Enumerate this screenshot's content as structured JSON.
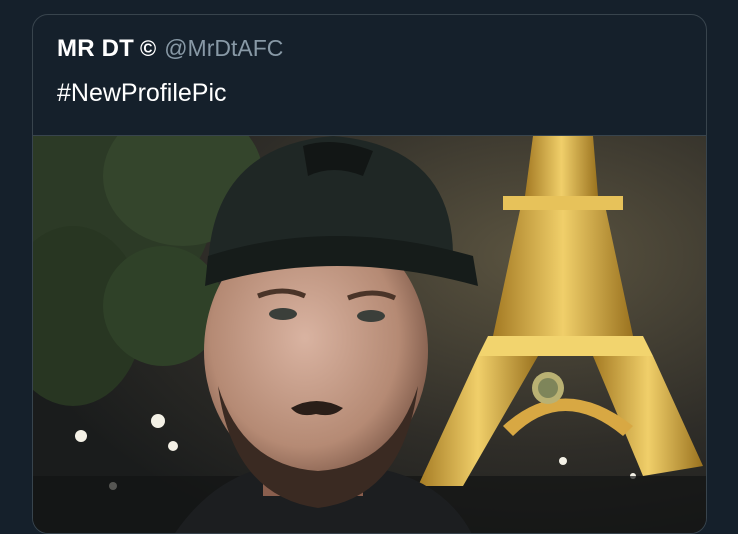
{
  "tweet": {
    "display_name": "MR DT",
    "badge": "©",
    "handle": "@MrDtAFC",
    "text": "#NewProfilePic"
  },
  "media": {
    "description_icon": "photo-icon"
  },
  "colors": {
    "background": "#15202b",
    "border": "#38444d",
    "handle": "#8899a6",
    "tower_light": "#d9b24a"
  }
}
